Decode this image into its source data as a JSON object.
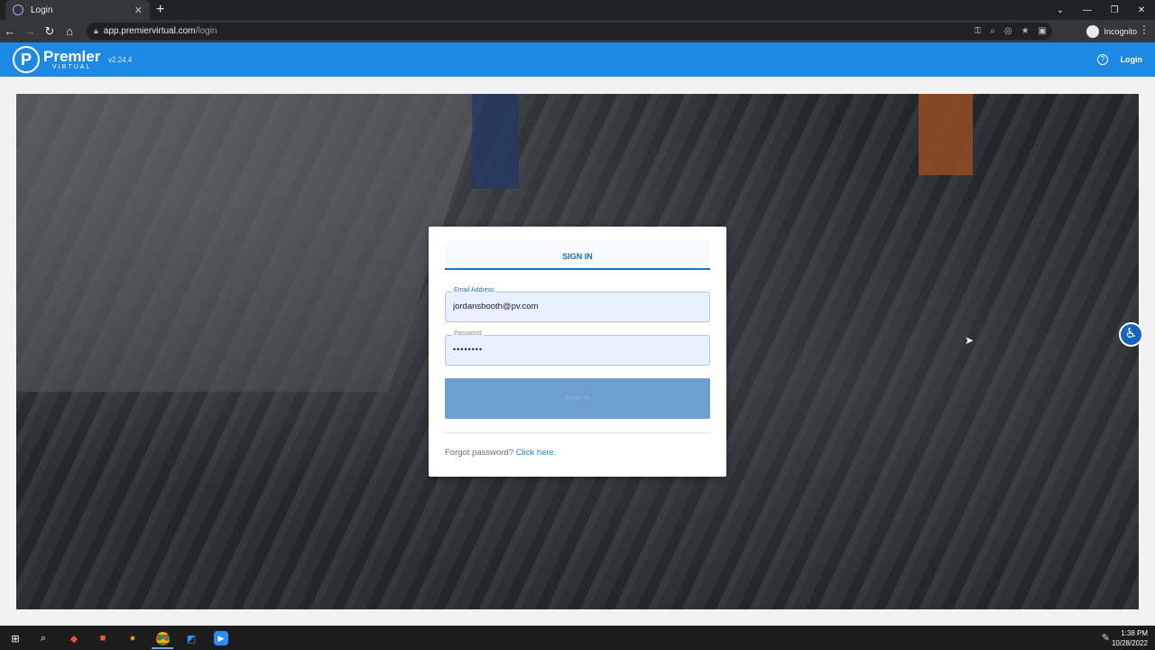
{
  "browser": {
    "tab_title": "Login",
    "tab_close": "✕",
    "new_tab": "+",
    "url_host": "app.premiervirtual.com",
    "url_path": "/login",
    "profile_label": "Incognito"
  },
  "app": {
    "logo_letter": "P",
    "logo_name": "Premler",
    "logo_sub": "VIRTUAL",
    "version": "v2.24.4",
    "login_link": "Login"
  },
  "signin": {
    "tab_label": "SIGN IN",
    "email_label": "Email Address",
    "email_value": "jordansbooth@pv.com",
    "password_label": "Password",
    "password_value": "••••••••",
    "button_label": "SIGN IN",
    "forgot_text": "Forgot password?",
    "forgot_link": "Click here."
  },
  "taskbar": {
    "time": "1:38 PM",
    "date": "10/28/2022"
  },
  "colors": {
    "app_bar": "#1e88e5",
    "signin_button": "#6ea0cf",
    "accent": "#1e6fb8"
  }
}
